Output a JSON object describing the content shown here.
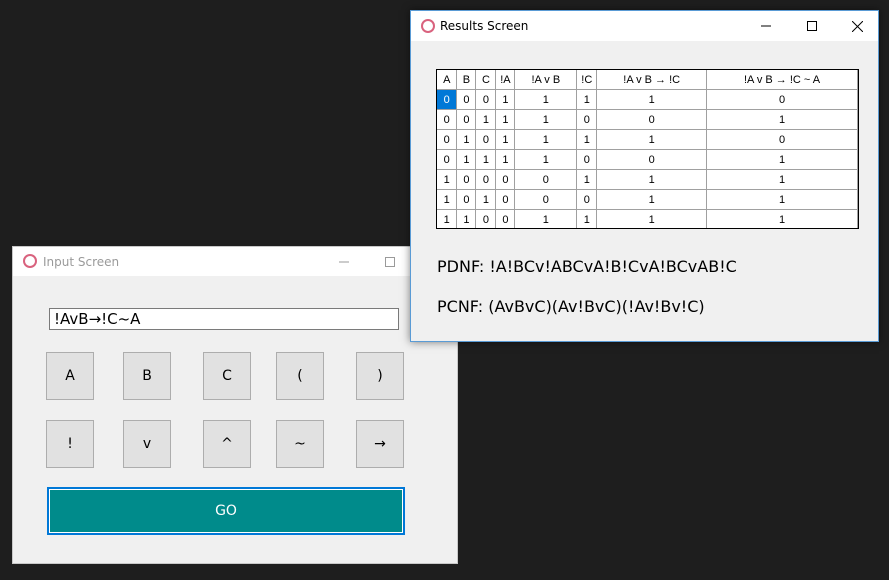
{
  "input_window": {
    "title": "Input Screen",
    "expression": "!AvB→!C~A",
    "keys_row1": [
      "A",
      "B",
      "C",
      "(",
      ")"
    ],
    "keys_row2": [
      "!",
      "v",
      "^",
      "~",
      "→"
    ],
    "go_label": "GO"
  },
  "results_window": {
    "title": "Results Screen",
    "columns": [
      "A",
      "B",
      "C",
      "!A",
      "!A v B",
      "!C",
      "!A v B → !C",
      "!A v B → !C ~ A"
    ],
    "rows": [
      [
        "0",
        "0",
        "0",
        "1",
        "1",
        "1",
        "1",
        "0"
      ],
      [
        "0",
        "0",
        "1",
        "1",
        "1",
        "0",
        "0",
        "1"
      ],
      [
        "0",
        "1",
        "0",
        "1",
        "1",
        "1",
        "1",
        "0"
      ],
      [
        "0",
        "1",
        "1",
        "1",
        "1",
        "0",
        "0",
        "1"
      ],
      [
        "1",
        "0",
        "0",
        "0",
        "0",
        "1",
        "1",
        "1"
      ],
      [
        "1",
        "0",
        "1",
        "0",
        "0",
        "0",
        "1",
        "1"
      ],
      [
        "1",
        "1",
        "0",
        "0",
        "1",
        "1",
        "1",
        "1"
      ]
    ],
    "pdnf": "PDNF: !A!BCv!ABCvA!B!CvA!BCvAB!C",
    "pcnf": "PCNF: (AvBvC)(Av!BvC)(!Av!Bv!C)"
  },
  "icons": {
    "app": "app-ring-icon",
    "minimize": "minimize-icon",
    "maximize": "maximize-icon",
    "close": "close-icon"
  },
  "colors": {
    "go_button": "#008b8b",
    "selection": "#0078d7",
    "app_icon": "#d9627e",
    "desktop": "#1e1e1e"
  }
}
